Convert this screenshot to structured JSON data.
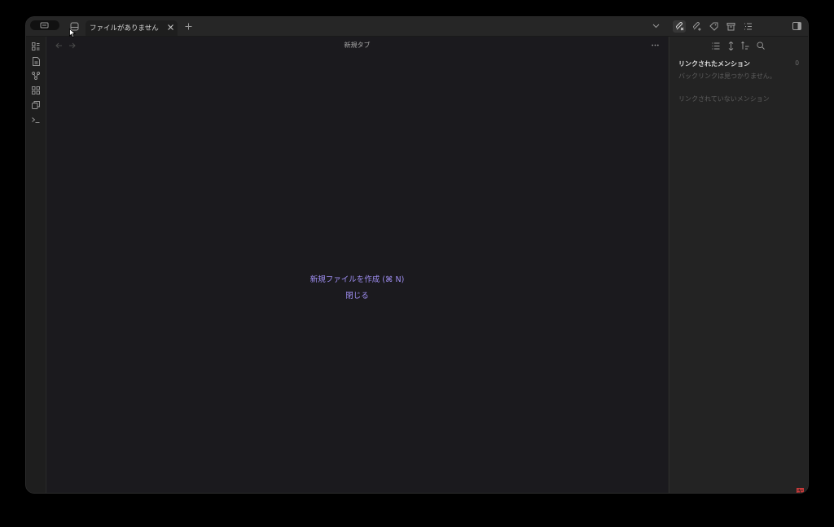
{
  "tabs": [
    {
      "label": "ファイルがありません",
      "active": true
    }
  ],
  "main": {
    "title": "新規タブ",
    "actions": [
      {
        "label": "新規ファイルを作成 (⌘ N)"
      },
      {
        "label": "閉じる"
      }
    ]
  },
  "backlinks": {
    "linked_heading": "リンクされたメンション",
    "linked_count": "0",
    "linked_empty": "バックリンクは見つかりません。",
    "unlinked_heading": "リンクされていないメンション"
  },
  "colors": {
    "accent": "#9f8ef2",
    "background": "#1e1e1e"
  },
  "icons": {
    "ribbon": [
      "dashboard-icon",
      "file-icon",
      "graph-icon",
      "blocks-icon",
      "copy-icon",
      "terminal-icon"
    ],
    "right_toolbar": [
      "backlinks-icon",
      "outgoing-links-icon",
      "tags-icon",
      "archive-icon",
      "outline-icon"
    ]
  }
}
